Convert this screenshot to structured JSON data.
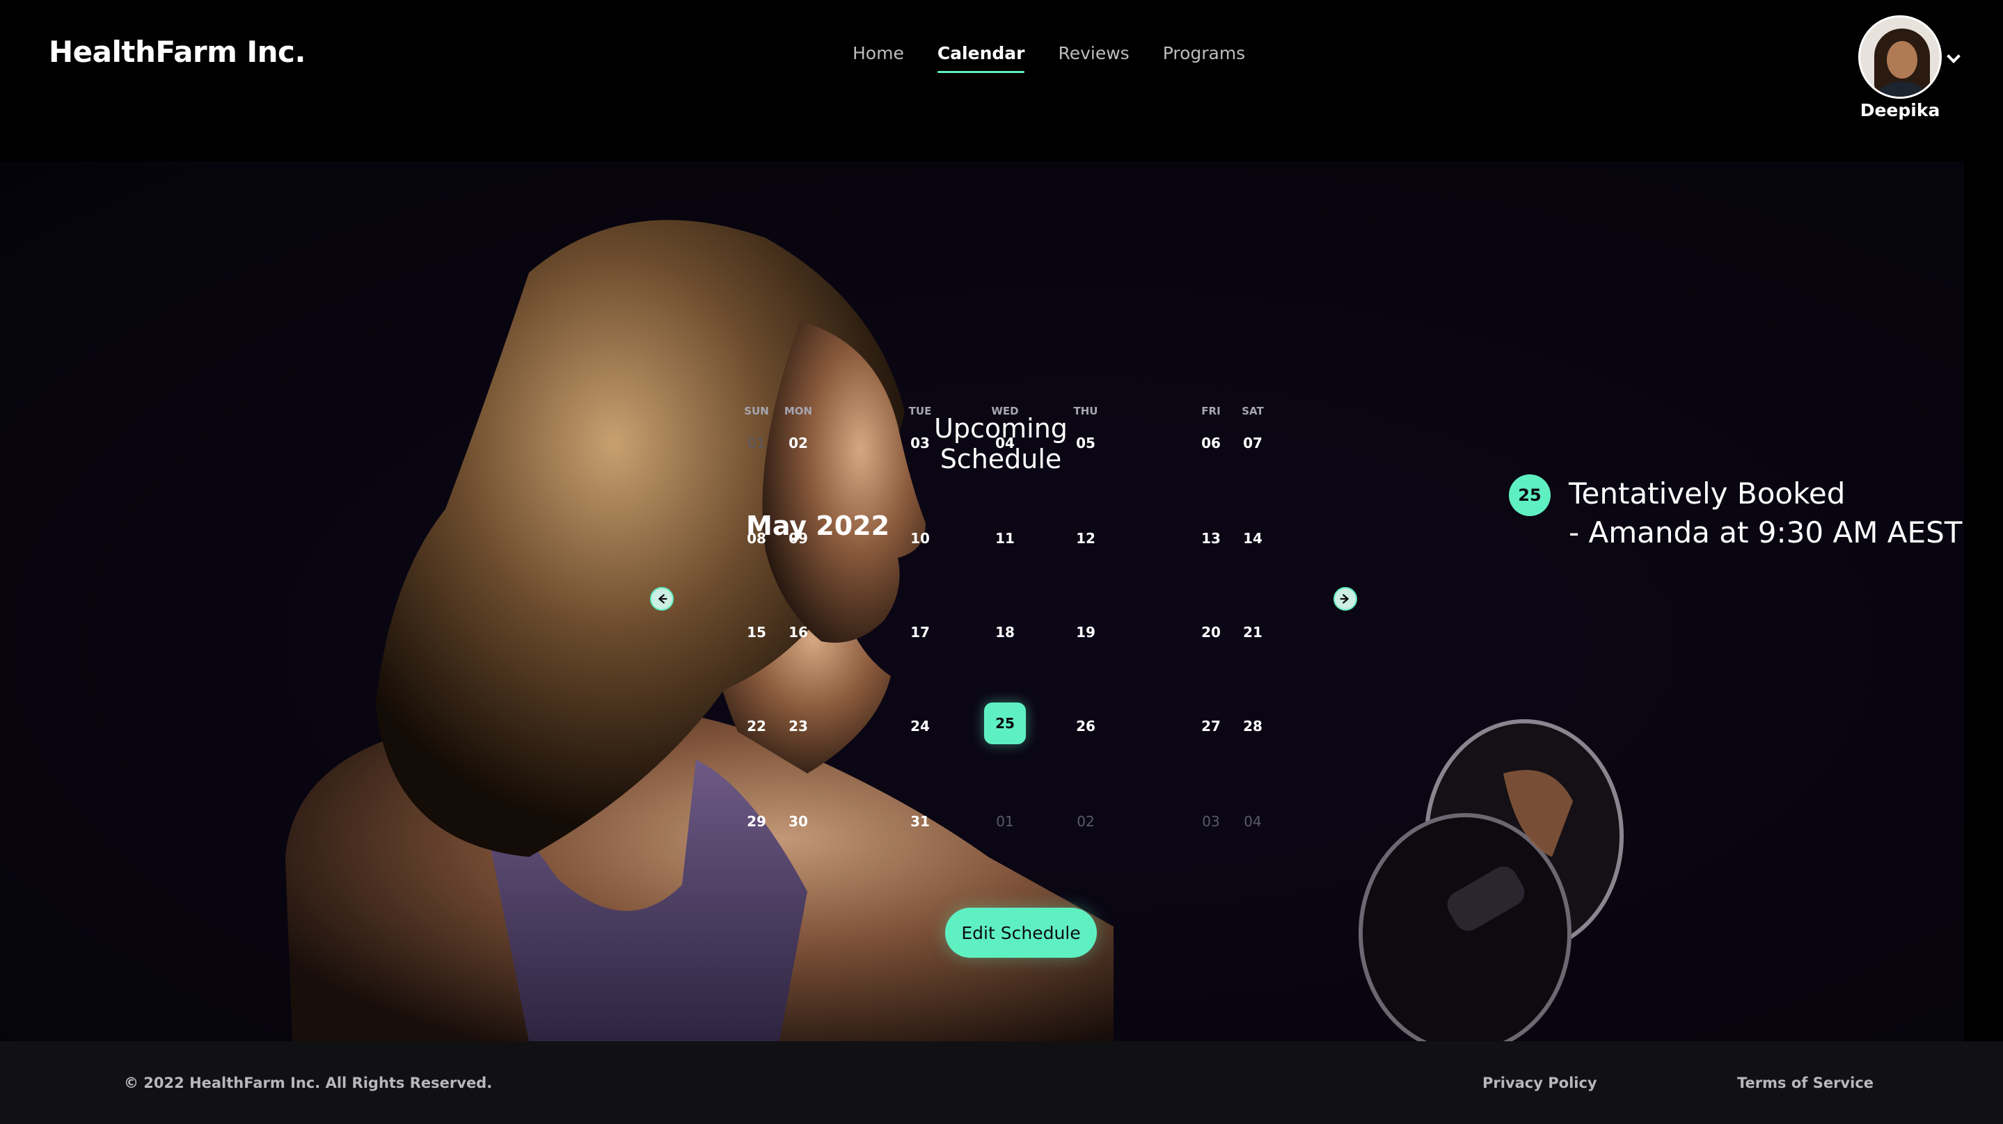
{
  "header": {
    "brand": "HealthFarm Inc.",
    "nav": [
      {
        "label": "Home",
        "active": false
      },
      {
        "label": "Calendar",
        "active": true
      },
      {
        "label": "Reviews",
        "active": false
      },
      {
        "label": "Programs",
        "active": false
      }
    ],
    "user": {
      "name": "Deepika"
    }
  },
  "schedule": {
    "title": "Upcoming Schedule",
    "month": "May 2022",
    "weekdays": [
      "SUN",
      "MON",
      "TUE",
      "WED",
      "THU",
      "FRI",
      "SAT"
    ],
    "weeks": [
      [
        "01",
        "02",
        "03",
        "04",
        "05",
        "06",
        "07"
      ],
      [
        "08",
        "09",
        "10",
        "11",
        "12",
        "13",
        "14"
      ],
      [
        "15",
        "16",
        "17",
        "18",
        "19",
        "20",
        "21"
      ],
      [
        "22",
        "23",
        "24",
        "25",
        "26",
        "27",
        "28"
      ],
      [
        "29",
        "30",
        "31",
        "01",
        "02",
        "03",
        "04"
      ]
    ],
    "selected_day": "25",
    "edit_button": "Edit Schedule"
  },
  "booking": {
    "badge": "25",
    "line1": "Tentatively Booked",
    "line2": "- Amanda at 9:30 AM AEST"
  },
  "footer": {
    "copyright": "© 2022 HealthFarm Inc.  All Rights Reserved.",
    "privacy": "Privacy Policy",
    "terms": "Terms of Service"
  },
  "colors": {
    "accent": "#5ff0c2",
    "background": "#000000"
  }
}
